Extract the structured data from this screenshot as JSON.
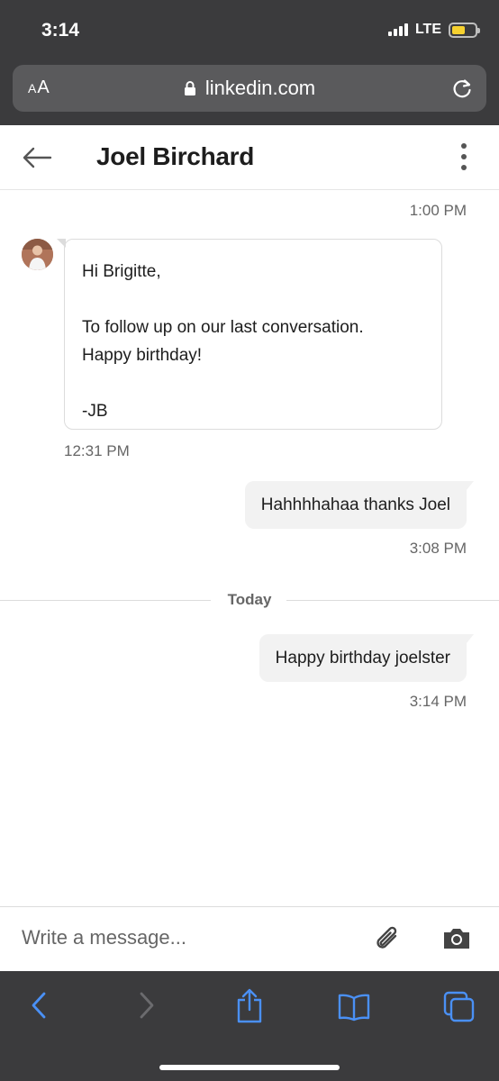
{
  "status_bar": {
    "time": "3:14",
    "network": "LTE"
  },
  "browser": {
    "text_size_label_big": "A",
    "text_size_label_small": "A",
    "url": "linkedin.com"
  },
  "header": {
    "title": "Joel Birchard"
  },
  "messages": {
    "ts_1": "1:00 PM",
    "incoming": {
      "line1": "Hi Brigitte,",
      "line2": "To follow up on our last conversation.",
      "line3": "Happy birthday!",
      "line4": "-JB",
      "time": "12:31 PM"
    },
    "out1": {
      "text": "Hahhhhahaa thanks Joel",
      "time": "3:08 PM"
    },
    "day_label": "Today",
    "out2": {
      "text": "Happy birthday joelster",
      "time": "3:14 PM"
    }
  },
  "compose": {
    "placeholder": "Write a message..."
  },
  "colors": {
    "chrome_bg": "#3b3b3d",
    "ios_blue": "#3b82f6",
    "bubble_out": "#f2f2f2"
  }
}
